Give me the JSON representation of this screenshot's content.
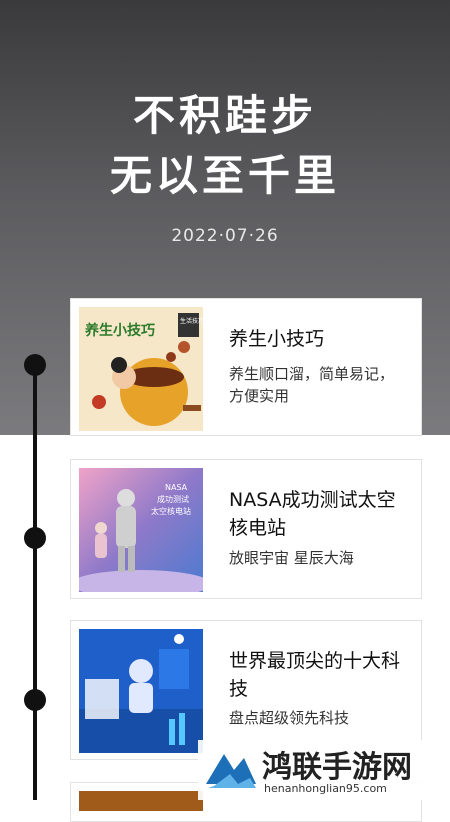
{
  "hero": {
    "line1": "不积跬步",
    "line2": "无以至千里",
    "date": "2022·07·26"
  },
  "cards": [
    {
      "title": "养生小技巧",
      "subtitle": "养生顺口溜，简单易记，方便实用",
      "thumb_label": "养生小技巧",
      "thumb_badge": "生活技巧"
    },
    {
      "title": "NASA成功测试太空核电站",
      "subtitle": "放眼宇宙 星辰大海",
      "thumb_label": "NASA\n成功测试\n太空核电站"
    },
    {
      "title": "世界最顶尖的十大科技",
      "subtitle": "盘点超级领先科技"
    }
  ],
  "watermark": {
    "text": "鸿联手游网",
    "url": "henanhonglian95.com"
  },
  "colors": {
    "hero_top": "#3a3a3c",
    "hero_bottom": "#7b7b7e",
    "timeline": "#111111"
  }
}
